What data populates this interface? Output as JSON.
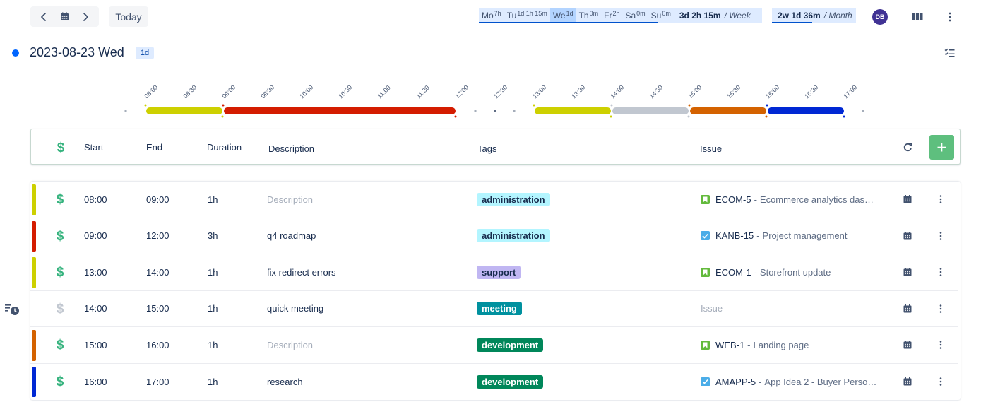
{
  "toolbar": {
    "today_label": "Today",
    "avatar_initials": "DB"
  },
  "week": {
    "days": [
      {
        "abbr": "Mo",
        "total": "7h",
        "selected": false
      },
      {
        "abbr": "Tu",
        "total": "1d 1h 15m",
        "selected": false
      },
      {
        "abbr": "We",
        "total": "1d",
        "selected": true
      },
      {
        "abbr": "Th",
        "total": "0m",
        "selected": false
      },
      {
        "abbr": "Fr",
        "total": "2h",
        "selected": false
      },
      {
        "abbr": "Sa",
        "total": "0m",
        "selected": false
      },
      {
        "abbr": "Su",
        "total": "0m",
        "selected": false
      }
    ],
    "total": "3d 2h 15m",
    "unit": "/ Week",
    "progress_fraction": 0.63
  },
  "month": {
    "total": "2w 1d 36m",
    "unit": "/ Month",
    "progress_fraction": 0.48
  },
  "date_header": {
    "title": "2023-08-23 Wed",
    "badge": "1d"
  },
  "timeline": {
    "ticks": [
      "08:00",
      "08:30",
      "09:00",
      "09:30",
      "10:00",
      "10:30",
      "11:00",
      "11:30",
      "12:00",
      "12:30",
      "13:00",
      "13:30",
      "14:00",
      "14:30",
      "15:00",
      "15:30",
      "16:00",
      "16:30",
      "17:00"
    ],
    "segments": [
      {
        "start": "08:00",
        "end": "09:00",
        "color": "#cdd000"
      },
      {
        "start": "09:00",
        "end": "12:00",
        "color": "#d41c00"
      },
      {
        "start": "13:00",
        "end": "14:00",
        "color": "#cdd000"
      },
      {
        "start": "14:00",
        "end": "15:00",
        "color": "#c1c7d0"
      },
      {
        "start": "15:00",
        "end": "16:00",
        "color": "#d46200"
      },
      {
        "start": "16:00",
        "end": "17:00",
        "color": "#0028d4"
      }
    ]
  },
  "columns": {
    "start": "Start",
    "end": "End",
    "duration": "Duration",
    "description": "Description",
    "tags": "Tags",
    "issue": "Issue"
  },
  "entries": [
    {
      "color": "#cdd000",
      "billable": true,
      "start": "08:00",
      "end": "09:00",
      "duration": "1h",
      "description": "",
      "description_placeholder": "Description",
      "tag": "administration",
      "tag_bg": "#b3f5ff",
      "tag_fg": "#172b4d",
      "issue_type": "story",
      "issue_key": "ECOM-5",
      "issue_sep": "-",
      "issue_name": "Ecommerce analytics dashb..."
    },
    {
      "color": "#d41c00",
      "billable": true,
      "start": "09:00",
      "end": "12:00",
      "duration": "3h",
      "description": "q4 roadmap",
      "description_placeholder": "Description",
      "tag": "administration",
      "tag_bg": "#b3f5ff",
      "tag_fg": "#172b4d",
      "issue_type": "task",
      "issue_key": "KANB-15",
      "issue_sep": "-",
      "issue_name": "Project management"
    },
    {
      "color": "#cdd000",
      "billable": true,
      "start": "13:00",
      "end": "14:00",
      "duration": "1h",
      "description": "fix redirect errors",
      "description_placeholder": "Description",
      "tag": "support",
      "tag_bg": "#c0b6f2",
      "tag_fg": "#172b4d",
      "issue_type": "story",
      "issue_key": "ECOM-1",
      "issue_sep": "-",
      "issue_name": "Storefront update"
    },
    {
      "color": "",
      "billable": false,
      "start": "14:00",
      "end": "15:00",
      "duration": "1h",
      "description": "quick meeting",
      "description_placeholder": "Description",
      "tag": "meeting",
      "tag_bg": "#00919f",
      "tag_fg": "#ffffff",
      "issue_type": "",
      "issue_key": "",
      "issue_sep": "",
      "issue_name": "",
      "issue_placeholder": "Issue"
    },
    {
      "color": "#d46200",
      "billable": true,
      "start": "15:00",
      "end": "16:00",
      "duration": "1h",
      "description": "",
      "description_placeholder": "Description",
      "tag": "development",
      "tag_bg": "#00875a",
      "tag_fg": "#ffffff",
      "issue_type": "story",
      "issue_key": "WEB-1",
      "issue_sep": "-",
      "issue_name": "Landing page"
    },
    {
      "color": "#0028d4",
      "billable": true,
      "start": "16:00",
      "end": "17:00",
      "duration": "1h",
      "description": "research",
      "description_placeholder": "Description",
      "tag": "development",
      "tag_bg": "#00875a",
      "tag_fg": "#ffffff",
      "issue_type": "task",
      "issue_key": "AMAPP-5",
      "issue_sep": "-",
      "issue_name": "App Idea 2 - Buyer Person..."
    }
  ],
  "icons": {
    "prev": "chevron-left-icon",
    "calendar": "calendar-icon",
    "next": "chevron-right-icon",
    "columns": "columns-view-icon",
    "more": "more-vertical-icon",
    "checklist": "checklist-icon",
    "refresh": "refresh-icon",
    "add": "plus-icon",
    "billable": "dollar-icon",
    "side": "list-clock-icon"
  },
  "colors": {
    "accent": "#0052cc",
    "billable": "#36b37e",
    "non_billable": "#c1c7d0",
    "add_button": "#5ebf7e"
  }
}
